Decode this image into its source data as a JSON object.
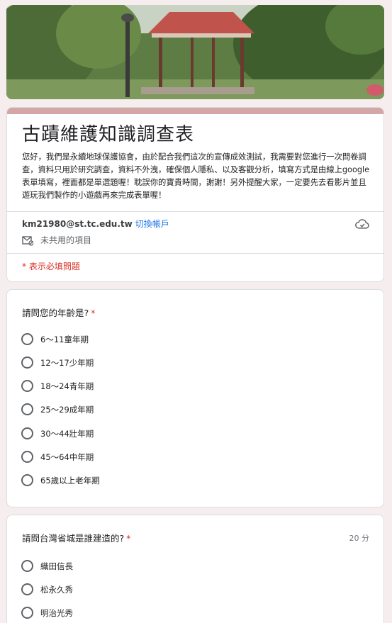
{
  "form": {
    "title": "古蹟維護知識調查表",
    "description": "您好，我們是永續地球保護協會，由於配合我們這次的宣傳成效測試，我需要對您進行一次問卷調查，資料只用於研究調查，資料不外洩，確保個人隱私、以及客觀分析，填寫方式是由線上google表單填寫，裡面都是單選題喔！耽誤你的寶貴時間，謝謝！另外提醒大家，一定要先去看影片並且遊玩我們製作的小遊戲再來完成表單喔！",
    "account_email": "km21980@st.tc.edu.tw",
    "switch_account_label": "切換帳戶",
    "not_shared_label": "未共用的項目",
    "required_note": "* 表示必填問題"
  },
  "questions": [
    {
      "title": "請問您的年齡是?",
      "required_mark": "*",
      "options": [
        "6～11童年期",
        "12～17少年期",
        "18～24青年期",
        "25～29成年期",
        "30～44壯年期",
        "45～64中年期",
        "65歲以上老年期"
      ]
    },
    {
      "title": "請問台灣省城是誰建造的?",
      "required_mark": "*",
      "points": "20 分",
      "options": [
        "織田信長",
        "松永久秀",
        "明治光秀"
      ]
    }
  ],
  "colors": {
    "page_bg": "#f6eeee",
    "header_accent": "#d3a7a5",
    "required_red": "#d93025",
    "link_blue": "#1a73e8"
  },
  "icons": {
    "cloud": "cloud-saved-icon",
    "not_shared": "mail-not-shared-icon"
  }
}
